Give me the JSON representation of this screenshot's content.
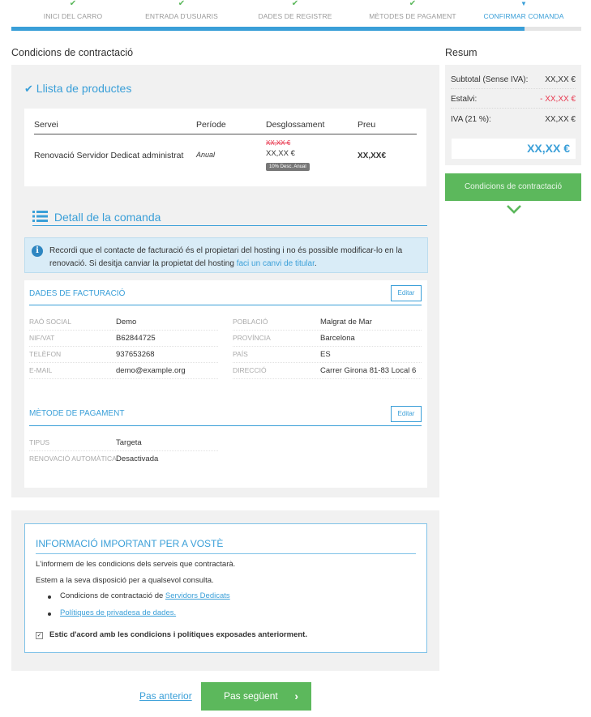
{
  "steps": [
    {
      "label": "INICI DEL CARRO"
    },
    {
      "label": "ENTRADA D'USUARIS"
    },
    {
      "label": "DADES DE REGISTRE"
    },
    {
      "label": "MÈTODES DE PAGAMENT"
    },
    {
      "label": "CONFIRMAR COMANDA"
    }
  ],
  "progress_pct": 90,
  "colors": {
    "accent": "#3a9fd8",
    "green": "#5cb85c",
    "red": "#e8384f"
  },
  "left": {
    "heading": "Condicions de contractació",
    "products": {
      "title": "Llista de productes",
      "headers": [
        "Servei",
        "Període",
        "Desglossament",
        "Preu"
      ],
      "row": {
        "service": "Renovació Servidor Dedicat administrat",
        "period": "Anual",
        "old_price": "XX,XX €",
        "new_price": "XX,XX €",
        "discount_tag": "10% Desc. Anual",
        "price": "XX,XX€"
      }
    },
    "detail": {
      "title": "Detall de la comanda",
      "info_text": "Recordi que el contacte de facturació és el propietari del hosting i no és possible modificar-lo en la renovació. Si desitja canviar la propietat del hosting",
      "info_link": "faci un canvi de titular",
      "info_end": "."
    },
    "billing": {
      "title": "DADES DE FACTURACIÓ",
      "edit": "Editar",
      "left_rows": [
        {
          "k": "RAÓ SOCIAL",
          "v": "Demo"
        },
        {
          "k": "NIF/VAT",
          "v": "B62844725"
        },
        {
          "k": "TELÈFON",
          "v": "937653268"
        },
        {
          "k": "E-MAIL",
          "v": "demo@example.org"
        }
      ],
      "right_rows": [
        {
          "k": "POBLACIÓ",
          "v": "Malgrat de Mar"
        },
        {
          "k": "PROVÍNCIA",
          "v": "Barcelona"
        },
        {
          "k": "PAÍS",
          "v": "ES"
        },
        {
          "k": "DIRECCIÓ",
          "v": "Carrer Girona 81-83 Local 6"
        }
      ]
    },
    "payment": {
      "title": "MÈTODE DE PAGAMENT",
      "edit": "Editar",
      "rows": [
        {
          "k": "TIPUS",
          "v": "Targeta"
        },
        {
          "k": "RENOVACIÓ AUTOMÀTICA",
          "v": "Desactivada"
        }
      ]
    }
  },
  "summary": {
    "heading": "Resum",
    "subtotal_label": "Subtotal (Sense IVA):",
    "subtotal": "XX,XX €",
    "saving_label": "Estalvi:",
    "saving": "- XX,XX €",
    "vat_label": "IVA (21 %):",
    "vat": "XX,XX €",
    "total": "XX,XX €",
    "conditions_button": "Condicions de contractació"
  },
  "important": {
    "title": "INFORMACIÓ IMPORTANT PER A VOSTÈ",
    "line1": "L'informem de les condicions dels serveis que contractarà.",
    "line2": "Estem a la seva disposició per a qualsevol consulta.",
    "bullet1_prefix": "Condicions de contractació de",
    "bullet1_link": "Servidors Dedicats",
    "bullet2_link": "Polítiques de privadesa de dades.",
    "agree": "Estic d'acord amb les condicions i polítiques exposades anteriorment."
  },
  "nav": {
    "prev": "Pas anterior",
    "next": "Pas següent"
  }
}
